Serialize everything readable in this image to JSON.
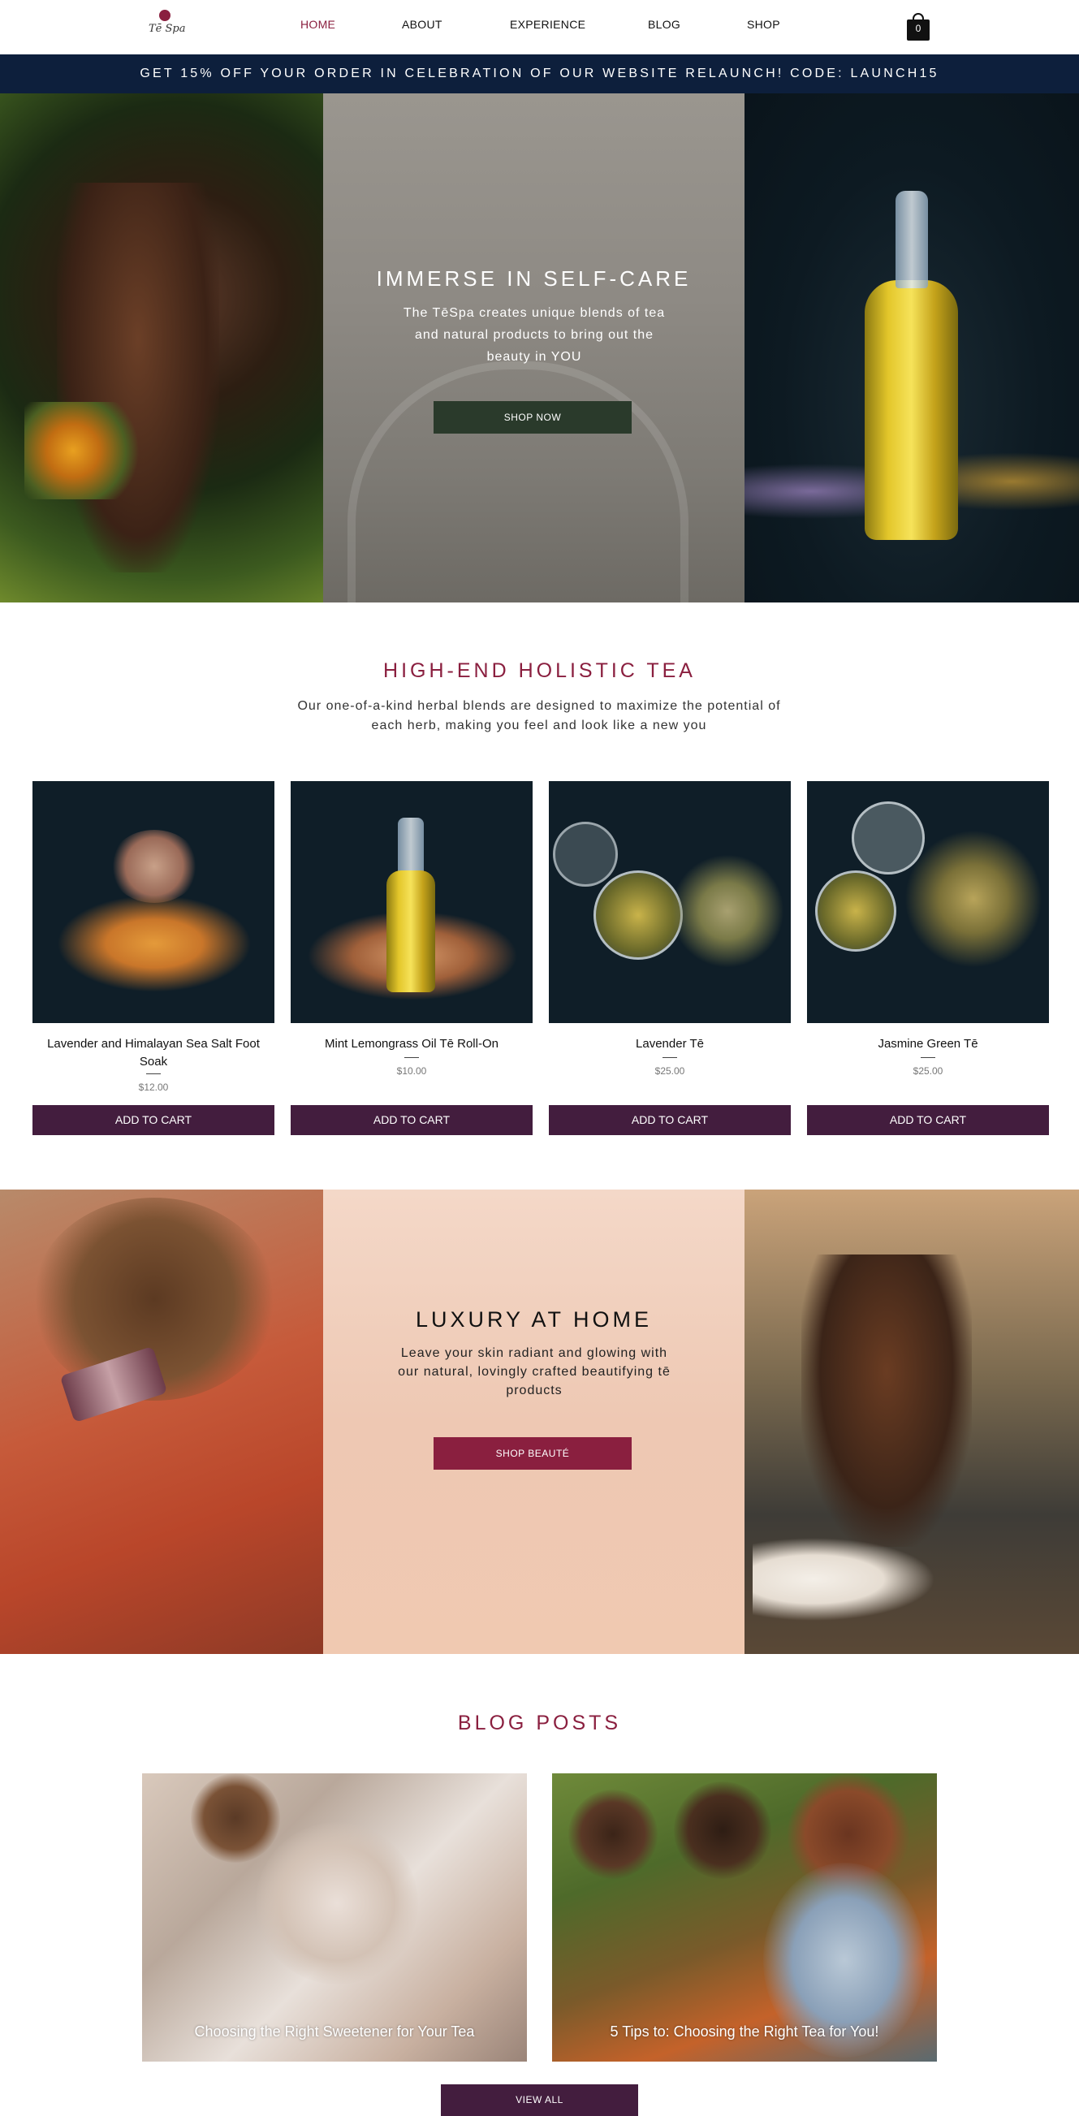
{
  "header": {
    "logo_text": "Tē Spa",
    "nav": [
      {
        "label": "HOME",
        "active": true
      },
      {
        "label": "ABOUT",
        "active": false
      },
      {
        "label": "EXPERIENCE",
        "active": false
      },
      {
        "label": "BLOG",
        "active": false
      },
      {
        "label": "SHOP",
        "active": false
      }
    ],
    "cart_count": "0",
    "cart_icon": "shopping-bag-icon"
  },
  "promo": {
    "text": "GET 15% OFF YOUR ORDER IN CELEBRATION OF OUR WEBSITE RELAUNCH! CODE: LAUNCH15"
  },
  "hero": {
    "title": "IMMERSE IN SELF-CARE",
    "body": "The TēSpa creates unique blends of tea and natural products to bring out the beauty in YOU",
    "button": "SHOP NOW"
  },
  "tea_section": {
    "title": "HIGH-END HOLISTIC TEA",
    "subtitle": "Our one-of-a-kind herbal blends are designed to maximize the potential of each herb, making you feel and look like a new you"
  },
  "products": [
    {
      "name": "Lavender and Himalayan Sea Salt Foot Soak",
      "price": "$12.00",
      "button": "ADD TO CART"
    },
    {
      "name": "Mint Lemongrass Oil Tē Roll-On",
      "price": "$10.00",
      "button": "ADD TO CART"
    },
    {
      "name": "Lavender Tē",
      "price": "$25.00",
      "button": "ADD TO CART"
    },
    {
      "name": "Jasmine Green Tē",
      "price": "$25.00",
      "button": "ADD TO CART"
    }
  ],
  "luxury": {
    "title": "LUXURY AT HOME",
    "body": "Leave your skin radiant and glowing with our natural, lovingly crafted beautifying tē products",
    "button": "SHOP BEAUTÉ"
  },
  "blog": {
    "title": "BLOG POSTS",
    "posts": [
      {
        "title": "Choosing the Right Sweetener for Your Tea"
      },
      {
        "title": "5 Tips to: Choosing the Right Tea for You!"
      }
    ],
    "view_all": "VIEW ALL"
  },
  "colors": {
    "accent": "#8a1f3f",
    "promo_bg": "#0d1f3c",
    "button_plum": "#431d3e",
    "button_dark_green": "#2a3a2b"
  }
}
